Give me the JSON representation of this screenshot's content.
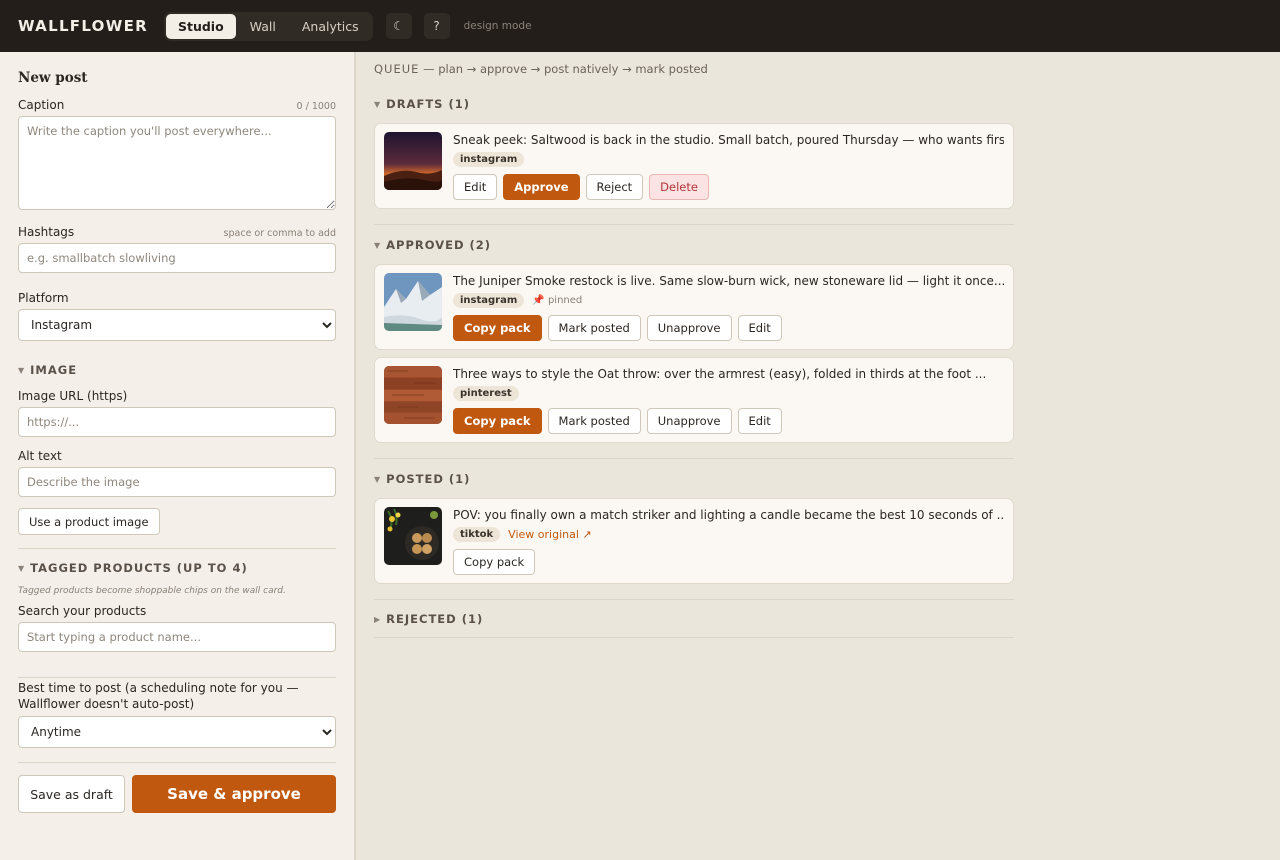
{
  "app": {
    "brand": "WALLFLOWER",
    "tabs": [
      {
        "label": "Studio",
        "active": true
      },
      {
        "label": "Wall",
        "active": false
      },
      {
        "label": "Analytics",
        "active": false
      }
    ],
    "theme_icon": "☾",
    "help_icon": "?",
    "mode_label": "design mode"
  },
  "form": {
    "title": "New post",
    "caption": {
      "label": "Caption",
      "counter": "0 / 1000",
      "placeholder": "Write the caption you'll post everywhere..."
    },
    "hashtags": {
      "label": "Hashtags",
      "hint": "space or comma to add",
      "placeholder": "e.g. smallbatch slowliving"
    },
    "platform": {
      "label": "Platform",
      "value": "Instagram"
    },
    "image_section": {
      "title": "IMAGE"
    },
    "image_url": {
      "label": "Image URL (https)",
      "placeholder": "https://..."
    },
    "alt_text": {
      "label": "Alt text",
      "placeholder": "Describe the image"
    },
    "use_product_image_label": "Use a product image",
    "tagged_section": {
      "title": "TAGGED PRODUCTS (UP TO 4)",
      "note": "Tagged products become shoppable chips on the wall card."
    },
    "search_products": {
      "label": "Search your products",
      "placeholder": "Start typing a product name..."
    },
    "best_time": {
      "label": "Best time to post (a scheduling note for you — Wallflower doesn't auto-post)",
      "value": "Anytime"
    },
    "save_draft_label": "Save as draft",
    "save_approve_label": "Save & approve"
  },
  "queue": {
    "label": "QUEUE",
    "flow": " — plan → approve → post natively → mark posted",
    "groups": {
      "drafts": {
        "title": "DRAFTS (1)",
        "cards": [
          {
            "caption": "Sneak peek: Saltwood is back in the studio. Small batch, poured Thursday — who wants firs...",
            "platform": "instagram",
            "thumb": "dusk-desert-photo",
            "actions": [
              "Edit",
              "Approve",
              "Reject",
              "Delete"
            ]
          }
        ]
      },
      "approved": {
        "title": "APPROVED (2)",
        "cards": [
          {
            "caption": "The Juniper Smoke restock is live. Same slow-burn wick, new stoneware lid — light it once...",
            "platform": "instagram",
            "pinned": "pinned",
            "thumb": "snowy-mountain-photo",
            "actions": [
              "Copy pack",
              "Mark posted",
              "Unapprove",
              "Edit"
            ]
          },
          {
            "caption": "Three ways to style the Oat throw: over the armrest (easy), folded in thirds at the foot ...",
            "platform": "pinterest",
            "thumb": "wood-planks-photo",
            "actions": [
              "Copy pack",
              "Mark posted",
              "Unapprove",
              "Edit"
            ]
          }
        ]
      },
      "posted": {
        "title": "POSTED (1)",
        "cards": [
          {
            "caption": "POV: you finally own a match striker and lighting a candle became the best 10 seconds of ...",
            "platform": "tiktok",
            "link": "View original ↗",
            "thumb": "cookies-plate-photo",
            "actions": [
              "Copy pack"
            ]
          }
        ]
      },
      "rejected": {
        "title": "REJECTED (1)"
      }
    }
  },
  "colors": {
    "accent": "#c0580f",
    "topbar": "#231e1a",
    "danger": "#b2343a"
  }
}
